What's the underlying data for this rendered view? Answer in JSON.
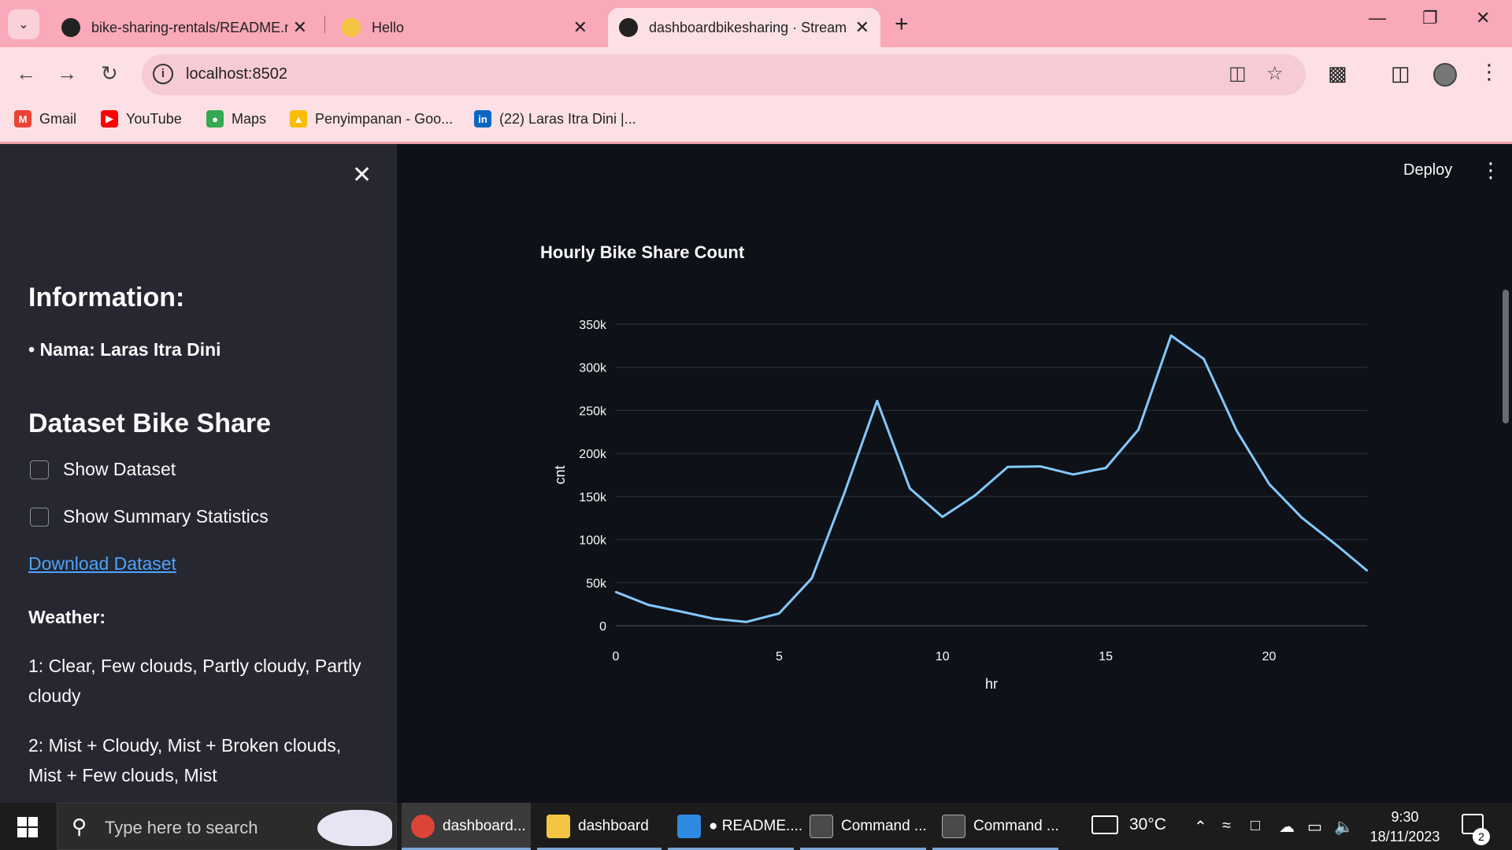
{
  "browser": {
    "tabs": [
      {
        "label": "bike-sharing-rentals/README.m",
        "icon": "github-icon"
      },
      {
        "label": "Hello",
        "icon": "waving-hand-icon"
      },
      {
        "label": "dashboardbikesharing · Streaml",
        "icon": "streamlit-icon"
      }
    ],
    "address": "localhost:8502",
    "bookmarks": [
      {
        "label": "Gmail",
        "color": "#ea4335"
      },
      {
        "label": "YouTube",
        "color": "#ff0000"
      },
      {
        "label": "Maps",
        "color": "#34a853"
      },
      {
        "label": "Penyimpanan - Goo...",
        "color": "#fbbc04"
      },
      {
        "label": "(22) Laras Itra Dini |...",
        "color": "#0a66c2"
      }
    ]
  },
  "sidebar": {
    "info_heading": "Information:",
    "name_line": "• Nama: Laras Itra Dini",
    "dataset_heading": "Dataset Bike Share",
    "checkbox_dataset": "Show Dataset",
    "checkbox_summary": "Show Summary Statistics",
    "download_link": "Download Dataset",
    "weather_heading": "Weather:",
    "weather_1": "1: Clear, Few clouds, Partly cloudy, Partly cloudy",
    "weather_2": "2: Mist + Cloudy, Mist + Broken clouds, Mist + Few clouds, Mist"
  },
  "header": {
    "deploy_label": "Deploy"
  },
  "chart_data": {
    "type": "line",
    "title": "Hourly Bike Share Count",
    "xlabel": "hr",
    "ylabel": "cnt",
    "x": [
      0,
      1,
      2,
      3,
      4,
      5,
      6,
      7,
      8,
      9,
      10,
      11,
      12,
      13,
      14,
      15,
      16,
      17,
      18,
      19,
      20,
      21,
      22,
      23
    ],
    "series": [
      {
        "values": [
          39130,
          24164,
          16352,
          8174,
          4428,
          14261,
          55132,
          154171,
          261001,
          159438,
          126257,
          151320,
          184414,
          184919,
          175652,
          183149,
          227748,
          336860,
          309772,
          226789,
          164550,
          125445,
          95612,
          63941
        ],
        "color": "#83c9ff"
      }
    ],
    "xlim": [
      0,
      23
    ],
    "ylim": [
      0,
      350000
    ],
    "x_ticks": [
      0,
      5,
      10,
      15,
      20
    ],
    "x_tick_labels": [
      "0",
      "5",
      "10",
      "15",
      "20"
    ],
    "y_ticks": [
      0,
      50000,
      100000,
      150000,
      200000,
      250000,
      300000,
      350000
    ],
    "y_tick_labels": [
      "0",
      "50k",
      "100k",
      "150k",
      "200k",
      "250k",
      "300k",
      "350k"
    ],
    "grid": true
  },
  "taskbar": {
    "search_placeholder": "Type here to search",
    "apps": [
      {
        "label": "dashboard...",
        "color": "#db4437"
      },
      {
        "label": "dashboard",
        "color": "#f4c542"
      },
      {
        "label": "● README....",
        "color": "#2d8ae0"
      },
      {
        "label": "Command ...",
        "color": "#4a4a4a"
      },
      {
        "label": "Command ...",
        "color": "#4a4a4a"
      }
    ],
    "temperature": "30°C",
    "time": "9:30",
    "date": "18/11/2023",
    "notification_count": "2"
  }
}
